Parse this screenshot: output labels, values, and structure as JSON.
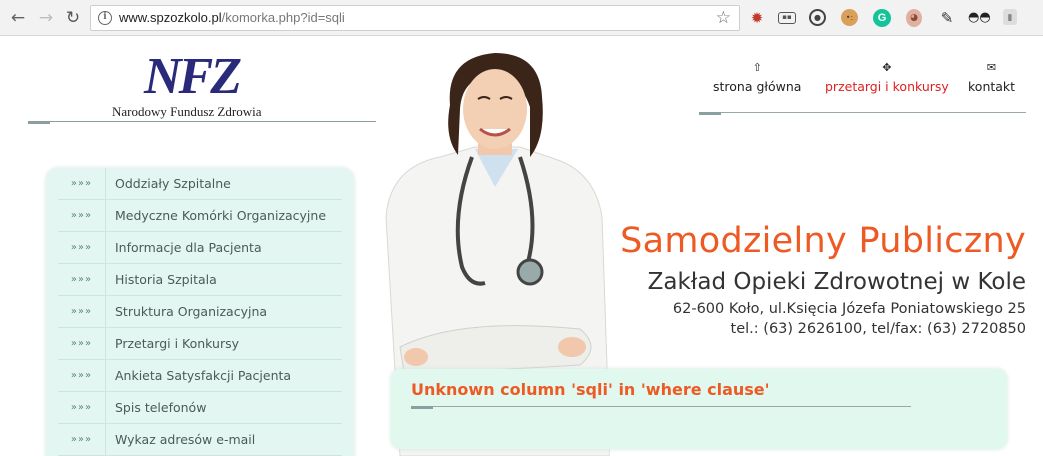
{
  "browser": {
    "url_host": "www.spzozkolo.pl",
    "url_path": "/komorka.php?id=sqli",
    "icons": [
      "back-icon",
      "forward-icon",
      "reload-icon",
      "info-icon",
      "star-icon"
    ],
    "extensions": [
      "ext-red-badge",
      "ext-monitor",
      "ext-circle",
      "ext-cookie",
      "ext-grammarly",
      "ext-brain",
      "ext-eyedropper",
      "ext-mask",
      "ext-grey-badge"
    ]
  },
  "logo": {
    "letters": "NFZ",
    "caption": "Narodowy Fundusz Zdrowia"
  },
  "menu": {
    "arrows": "»»»",
    "items": [
      "Oddziały Szpitalne",
      "Medyczne Komórki Organizacyjne",
      "Informacje dla Pacjenta",
      "Historia Szpitala",
      "Struktura Organizacyjna",
      "Przetargi i Konkursy",
      "Ankieta Satysfakcji Pacjenta",
      "Spis telefonów",
      "Wykaz adresów e-mail"
    ]
  },
  "topnav": {
    "home": "strona główna",
    "tenders": "przetargi i konkursy",
    "contact": "kontakt"
  },
  "header": {
    "title": "Samodzielny Publiczny",
    "subtitle": "Zakład Opieki Zdrowotnej w Kole",
    "address": "62-600 Koło, ul.Księcia Józefa Poniatowskiego 25",
    "phone": "tel.: (63) 2626100, tel/fax: (63) 2720850"
  },
  "content": {
    "error": "Unknown column 'sqli' in 'where clause'"
  },
  "colors": {
    "accent": "#ee5a24",
    "menu_bg": "#e3f6f1",
    "logo_blue": "#2a2a7a",
    "active_nav": "#e02020"
  }
}
